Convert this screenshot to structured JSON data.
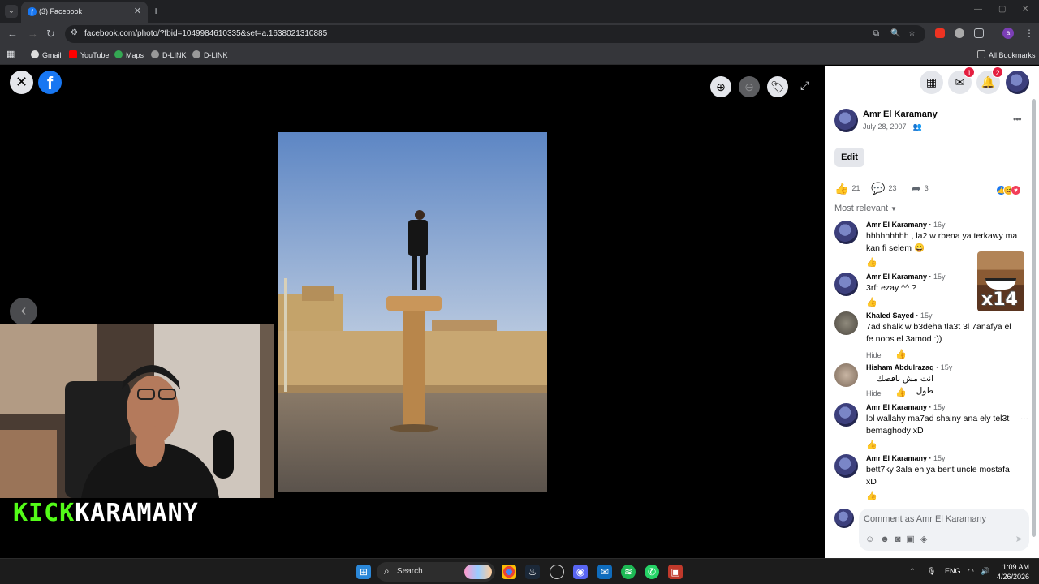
{
  "browser": {
    "tab_title": "(3) Facebook",
    "url": "facebook.com/photo/?fbid=1049984610335&set=a.1638021310885",
    "bookmarks": [
      "Gmail",
      "YouTube",
      "Maps",
      "D-LINK",
      "D-LINK"
    ],
    "all_bookmarks": "All Bookmarks",
    "profile_initial": "a"
  },
  "viewer": {
    "brand_kick": "KICK",
    "brand_name": "KARAMANY"
  },
  "topbar": {
    "messenger_badge": "1",
    "notifications_badge": "2"
  },
  "post": {
    "author": "Amr El Karamany",
    "date": "July 28, 2007 · ",
    "edit_label": "Edit",
    "likes": "21",
    "comments": "23",
    "shares": "3",
    "sort_label": "Most relevant"
  },
  "comments": [
    {
      "name": "Amr El Karamany",
      "ago": "16y",
      "text": "hhhhhhhhh , la2 w rbena ya terkawy ma kan fi selem 😀"
    },
    {
      "name": "Amr El Karamany",
      "ago": "15y",
      "text": "3rft ezay ^^ ?"
    },
    {
      "name": "Khaled Sayed",
      "ago": "15y",
      "text": "7ad shalk w b3deha tla3t 3l 7anafya el fe noos el 3amod :))",
      "hide": "Hide"
    },
    {
      "name": "Hisham Abdulrazaq",
      "ago": "15y",
      "text": "انت مش ناقصك طول",
      "hide": "Hide"
    },
    {
      "name": "Amr El Karamany",
      "ago": "15y",
      "text": "lol wallahy ma7ad shalny ana ely tel3t bemaghody xD"
    },
    {
      "name": "Amr El Karamany",
      "ago": "15y",
      "text": "bett7ky 3ala eh ya bent uncle mostafa xD"
    }
  ],
  "sticker_text": "x14",
  "composer": {
    "placeholder": "Comment as Amr El Karamany"
  },
  "taskbar": {
    "search_label": "Search",
    "lang": "ENG",
    "time": "1:09 AM",
    "date": "4/26/2026"
  }
}
